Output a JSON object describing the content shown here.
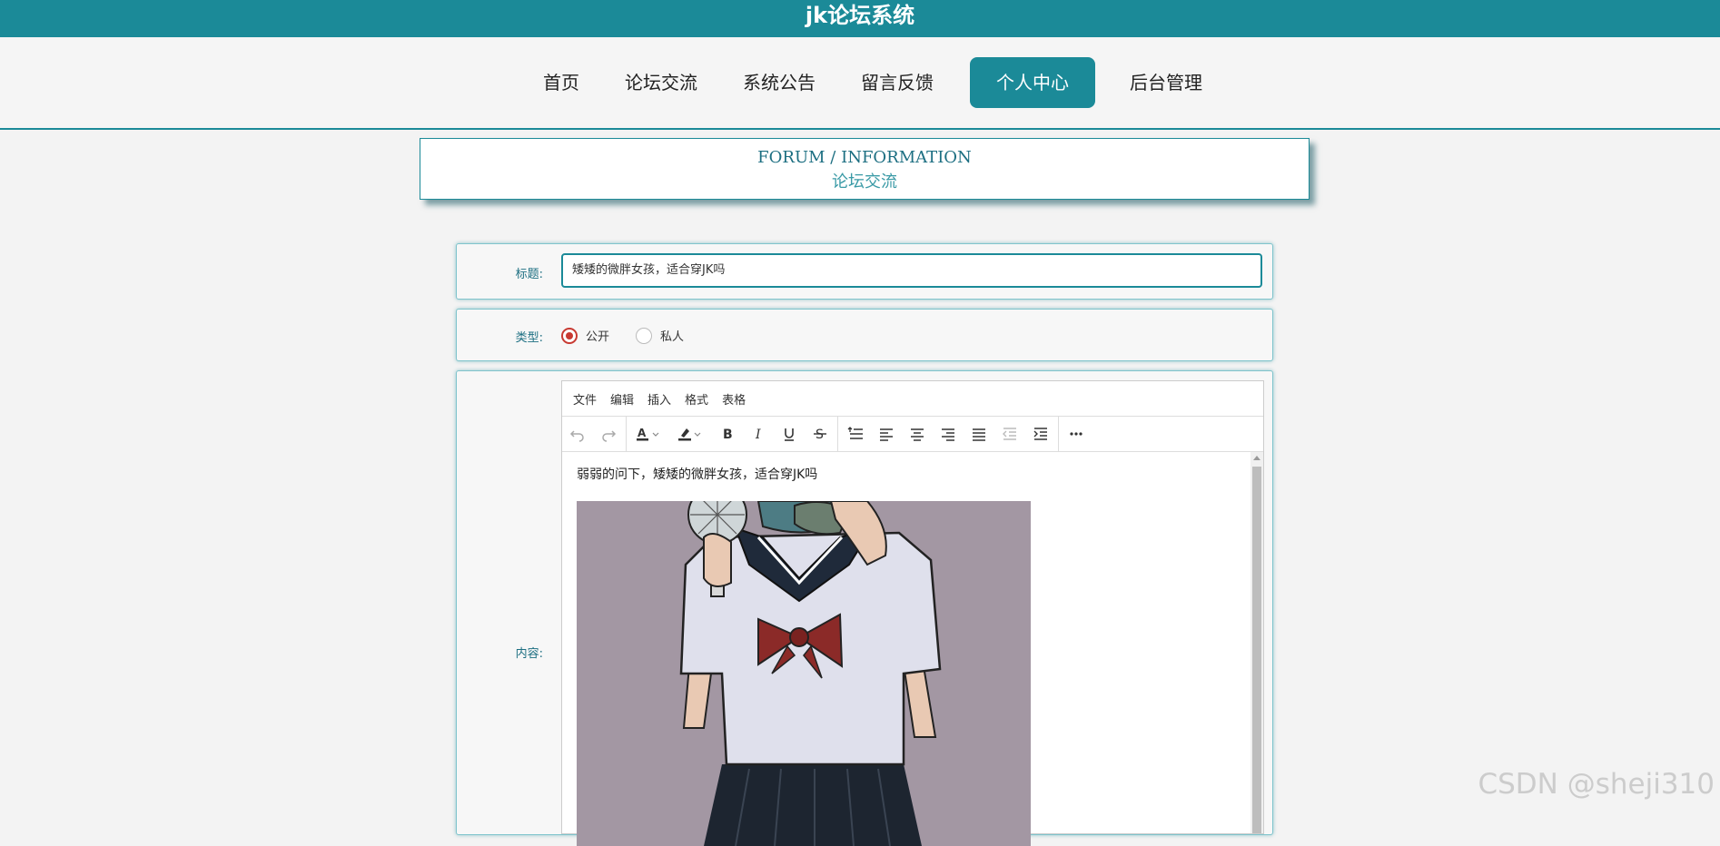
{
  "app": {
    "title": "jk论坛系统"
  },
  "nav": {
    "items": [
      "首页",
      "论坛交流",
      "系统公告",
      "留言反馈",
      "个人中心",
      "后台管理"
    ],
    "active_index": 4
  },
  "header": {
    "en": "FORUM / INFORMATION",
    "cn": "论坛交流"
  },
  "form": {
    "title_label": "标题:",
    "title_value": "矮矮的微胖女孩，适合穿JK吗",
    "type_label": "类型:",
    "type_options": [
      "公开",
      "私人"
    ],
    "type_selected": "公开",
    "content_label": "内容:"
  },
  "editor": {
    "menus": [
      "文件",
      "编辑",
      "插入",
      "格式",
      "表格"
    ],
    "toolbar_icons": [
      "undo-icon",
      "redo-icon",
      "text-color-icon",
      "highlight-icon",
      "bold-icon",
      "italic-icon",
      "underline-icon",
      "strikethrough-icon",
      "line-height-icon",
      "align-left-icon",
      "align-center-icon",
      "align-right-icon",
      "justify-icon",
      "outdent-icon",
      "indent-icon",
      "more-icon"
    ],
    "body_text": "弱弱的问下，矮矮的微胖女孩，适合穿JK吗"
  },
  "watermark": "CSDN @sheji310",
  "colors": {
    "primary": "#1b8a98",
    "radio": "#c83a32",
    "image_bg": "#a397a3"
  }
}
